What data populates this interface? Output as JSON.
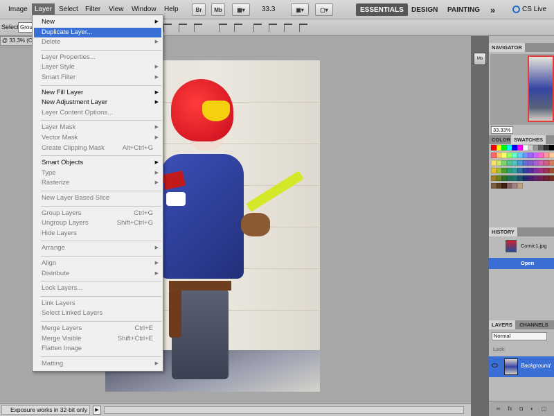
{
  "menubar": {
    "items": [
      "Image",
      "Layer",
      "Select",
      "Filter",
      "View",
      "Window",
      "Help"
    ],
    "app_buttons": [
      "Br",
      "Mb"
    ],
    "zoom": "33.3",
    "workspaces": [
      "ESSENTIALS",
      "DESIGN",
      "PAINTING"
    ],
    "more": "»",
    "cslive": "CS Live"
  },
  "options_bar": {
    "select_label": "Select:",
    "select_value": "Grou"
  },
  "document": {
    "tab_label": "@ 33.3% (C",
    "status_text": "Exposure works in 32-bit only",
    "status_arrow": "▶"
  },
  "layer_menu": {
    "items": [
      {
        "label": "New",
        "submenu": true,
        "enabled": true
      },
      {
        "label": "Duplicate Layer...",
        "selected": true,
        "enabled": true
      },
      {
        "label": "Delete",
        "submenu": true,
        "enabled": false
      },
      {
        "separator": true
      },
      {
        "label": "Layer Properties...",
        "enabled": false
      },
      {
        "label": "Layer Style",
        "submenu": true,
        "enabled": false
      },
      {
        "label": "Smart Filter",
        "submenu": true,
        "enabled": false
      },
      {
        "separator": true
      },
      {
        "label": "New Fill Layer",
        "submenu": true,
        "enabled": true
      },
      {
        "label": "New Adjustment Layer",
        "submenu": true,
        "enabled": true
      },
      {
        "label": "Layer Content Options...",
        "enabled": false
      },
      {
        "separator": true
      },
      {
        "label": "Layer Mask",
        "submenu": true,
        "enabled": false
      },
      {
        "label": "Vector Mask",
        "submenu": true,
        "enabled": false
      },
      {
        "label": "Create Clipping Mask",
        "shortcut": "Alt+Ctrl+G",
        "enabled": false
      },
      {
        "separator": true
      },
      {
        "label": "Smart Objects",
        "submenu": true,
        "enabled": true
      },
      {
        "label": "Type",
        "submenu": true,
        "enabled": false
      },
      {
        "label": "Rasterize",
        "submenu": true,
        "enabled": false
      },
      {
        "separator": true
      },
      {
        "label": "New Layer Based Slice",
        "enabled": false
      },
      {
        "separator": true
      },
      {
        "label": "Group Layers",
        "shortcut": "Ctrl+G",
        "enabled": false
      },
      {
        "label": "Ungroup Layers",
        "shortcut": "Shift+Ctrl+G",
        "enabled": false
      },
      {
        "label": "Hide Layers",
        "enabled": false
      },
      {
        "separator": true
      },
      {
        "label": "Arrange",
        "submenu": true,
        "enabled": false
      },
      {
        "separator": true
      },
      {
        "label": "Align",
        "submenu": true,
        "enabled": false
      },
      {
        "label": "Distribute",
        "submenu": true,
        "enabled": false
      },
      {
        "separator": true
      },
      {
        "label": "Lock Layers...",
        "enabled": false
      },
      {
        "separator": true
      },
      {
        "label": "Link Layers",
        "enabled": false
      },
      {
        "label": "Select Linked Layers",
        "enabled": false
      },
      {
        "separator": true
      },
      {
        "label": "Merge Layers",
        "shortcut": "Ctrl+E",
        "enabled": false
      },
      {
        "label": "Merge Visible",
        "shortcut": "Shift+Ctrl+E",
        "enabled": false
      },
      {
        "label": "Flatten Image",
        "enabled": false
      },
      {
        "separator": true
      },
      {
        "label": "Matting",
        "submenu": true,
        "enabled": false
      }
    ]
  },
  "panels": {
    "navigator": {
      "tab": "NAVIGATOR",
      "zoom": "33.33%"
    },
    "color_tabs": [
      "COLOR",
      "SWATCHES"
    ],
    "history": {
      "tab": "HISTORY",
      "snapshot": "Comic1.jpg",
      "state": "Open"
    },
    "layers": {
      "tabs": [
        "LAYERS",
        "CHANNELS"
      ],
      "blend_mode": "Normal",
      "lock_label": "Lock:",
      "layer_name": "Background",
      "footer_icons": [
        "∞",
        "fx",
        "◘",
        "◐",
        "▢"
      ]
    },
    "swatch_colors": [
      "#ff0000",
      "#ffff00",
      "#00ff00",
      "#00ffff",
      "#0000ff",
      "#ff00ff",
      "#ffffff",
      "#cccccc",
      "#999999",
      "#666666",
      "#333333",
      "#000000",
      "#ff6666",
      "#ffcc66",
      "#ffff66",
      "#99ff66",
      "#66ffcc",
      "#66ccff",
      "#6699ff",
      "#9966ff",
      "#cc66ff",
      "#ff66cc",
      "#ff9999",
      "#ffcc99",
      "#f7e36b",
      "#c8e86b",
      "#7fd36b",
      "#54c48f",
      "#4fc3c3",
      "#4f9ad3",
      "#5f6fd3",
      "#7f5fd3",
      "#a85fd3",
      "#d35fb3",
      "#d35f7f",
      "#d37f5f",
      "#e0c030",
      "#a0c030",
      "#50a030",
      "#30a070",
      "#30a0a0",
      "#3070a0",
      "#3040a0",
      "#5030a0",
      "#8030a0",
      "#a03080",
      "#a03050",
      "#a05030",
      "#a08020",
      "#708020",
      "#307020",
      "#207050",
      "#207070",
      "#205070",
      "#202a70",
      "#402070",
      "#602070",
      "#702050",
      "#702030",
      "#703020",
      "#806040",
      "#604020",
      "#402010",
      "#806060",
      "#a08080",
      "#c0a080"
    ]
  }
}
